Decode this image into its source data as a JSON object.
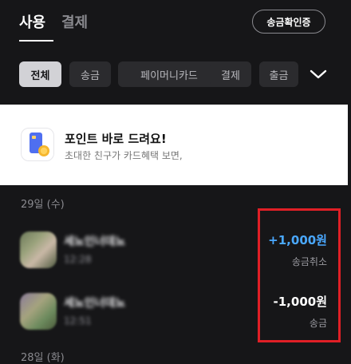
{
  "tabs": [
    {
      "label": "사용",
      "active": true
    },
    {
      "label": "결제",
      "active": false
    }
  ],
  "verify_button": "송금확인증",
  "filters": [
    {
      "label": "전체",
      "selected": true
    },
    {
      "label": "송금",
      "selected": false
    },
    {
      "label": "페이머니카드",
      "selected": false
    },
    {
      "label": "결제",
      "selected": false
    },
    {
      "label": "출금",
      "selected": false
    }
  ],
  "filters_expand_icon": "chevron-down-icon",
  "banner": {
    "icon": "card-coin-icon",
    "title": "포인트 바로 드려요!",
    "subtitle": "초대한 친구가 카드혜택 보면,"
  },
  "date_header": "29일 (수)",
  "transactions": [
    {
      "title": "세뇨인너데뇨",
      "subtitle": "12:28",
      "amount": "+1,000원",
      "status": "송금취소",
      "amount_color": "#4aa8ff"
    },
    {
      "title": "세뇨인너데뇨",
      "subtitle": "12:51",
      "amount": "-1,000원",
      "status": "송금",
      "amount_color": "#ffffff"
    }
  ],
  "next_date_header": "28일 (화)",
  "colors": {
    "background": "#161618",
    "accent": "#4aa8ff",
    "highlight": "#e01f26"
  }
}
